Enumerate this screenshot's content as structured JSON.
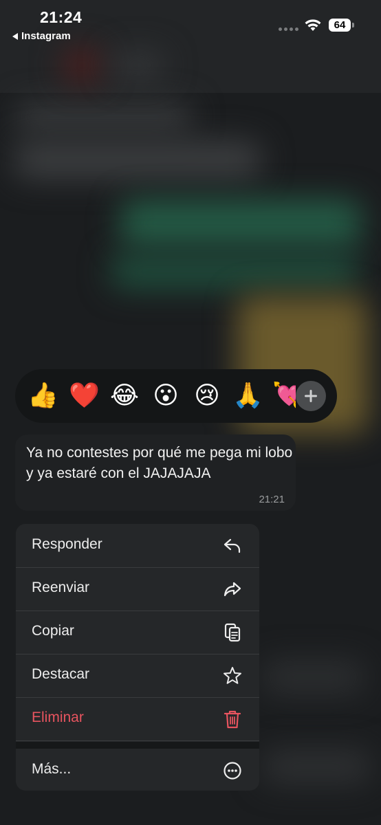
{
  "status_bar": {
    "time": "21:24",
    "back_app": "Instagram",
    "battery": "64"
  },
  "reactions": {
    "emojis": [
      "👍",
      "❤️",
      "😂",
      "😮",
      "😢",
      "🙏",
      "💘"
    ],
    "more_label": "+"
  },
  "message": {
    "text": "Ya no contestes por qué me pega mi lobo y ya estaré con el JAJAJAJA",
    "time": "21:21"
  },
  "menu": {
    "items": [
      {
        "label": "Responder",
        "icon": "reply-icon"
      },
      {
        "label": "Reenviar",
        "icon": "forward-icon"
      },
      {
        "label": "Copiar",
        "icon": "copy-icon"
      },
      {
        "label": "Destacar",
        "icon": "star-icon"
      },
      {
        "label": "Eliminar",
        "icon": "trash-icon"
      }
    ],
    "more": {
      "label": "Más...",
      "icon": "more-icon"
    }
  },
  "colors": {
    "danger": "#e8545f",
    "menu_bg": "#252729",
    "reaction_bg": "#141617"
  }
}
